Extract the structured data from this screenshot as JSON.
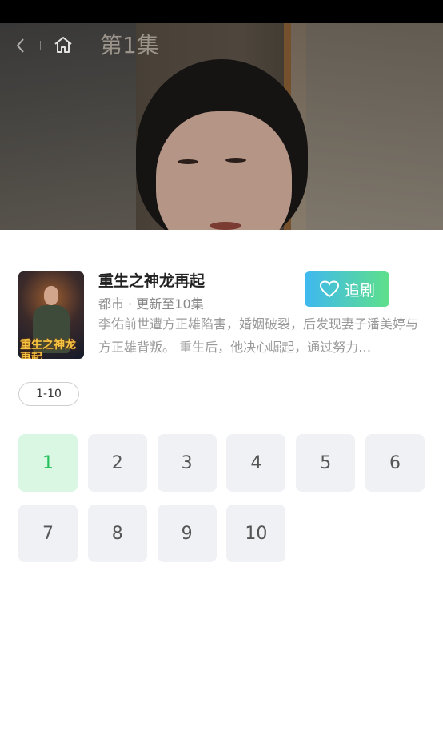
{
  "header": {
    "title": "第1集"
  },
  "drama": {
    "poster_title": "重生之神龙再起",
    "title": "重生之神龙再起",
    "meta": "都市 · 更新至10集",
    "description": "李佑前世遭方正雄陷害，婚姻破裂，后发现妻子潘美婷与方正雄背叛。 重生后，他决心崛起，通过努力…",
    "follow_label": "追剧"
  },
  "range": {
    "label": "1-10"
  },
  "episodes": [
    "1",
    "2",
    "3",
    "4",
    "5",
    "6",
    "7",
    "8",
    "9",
    "10"
  ],
  "active_episode": "1",
  "colors": {
    "accent_green": "#22c15a",
    "follow_gradient_start": "#3fb8f0",
    "follow_gradient_end": "#5ee08a"
  },
  "icons": {
    "back": "chevron-left-icon",
    "home": "home-icon",
    "heart": "heart-icon"
  }
}
